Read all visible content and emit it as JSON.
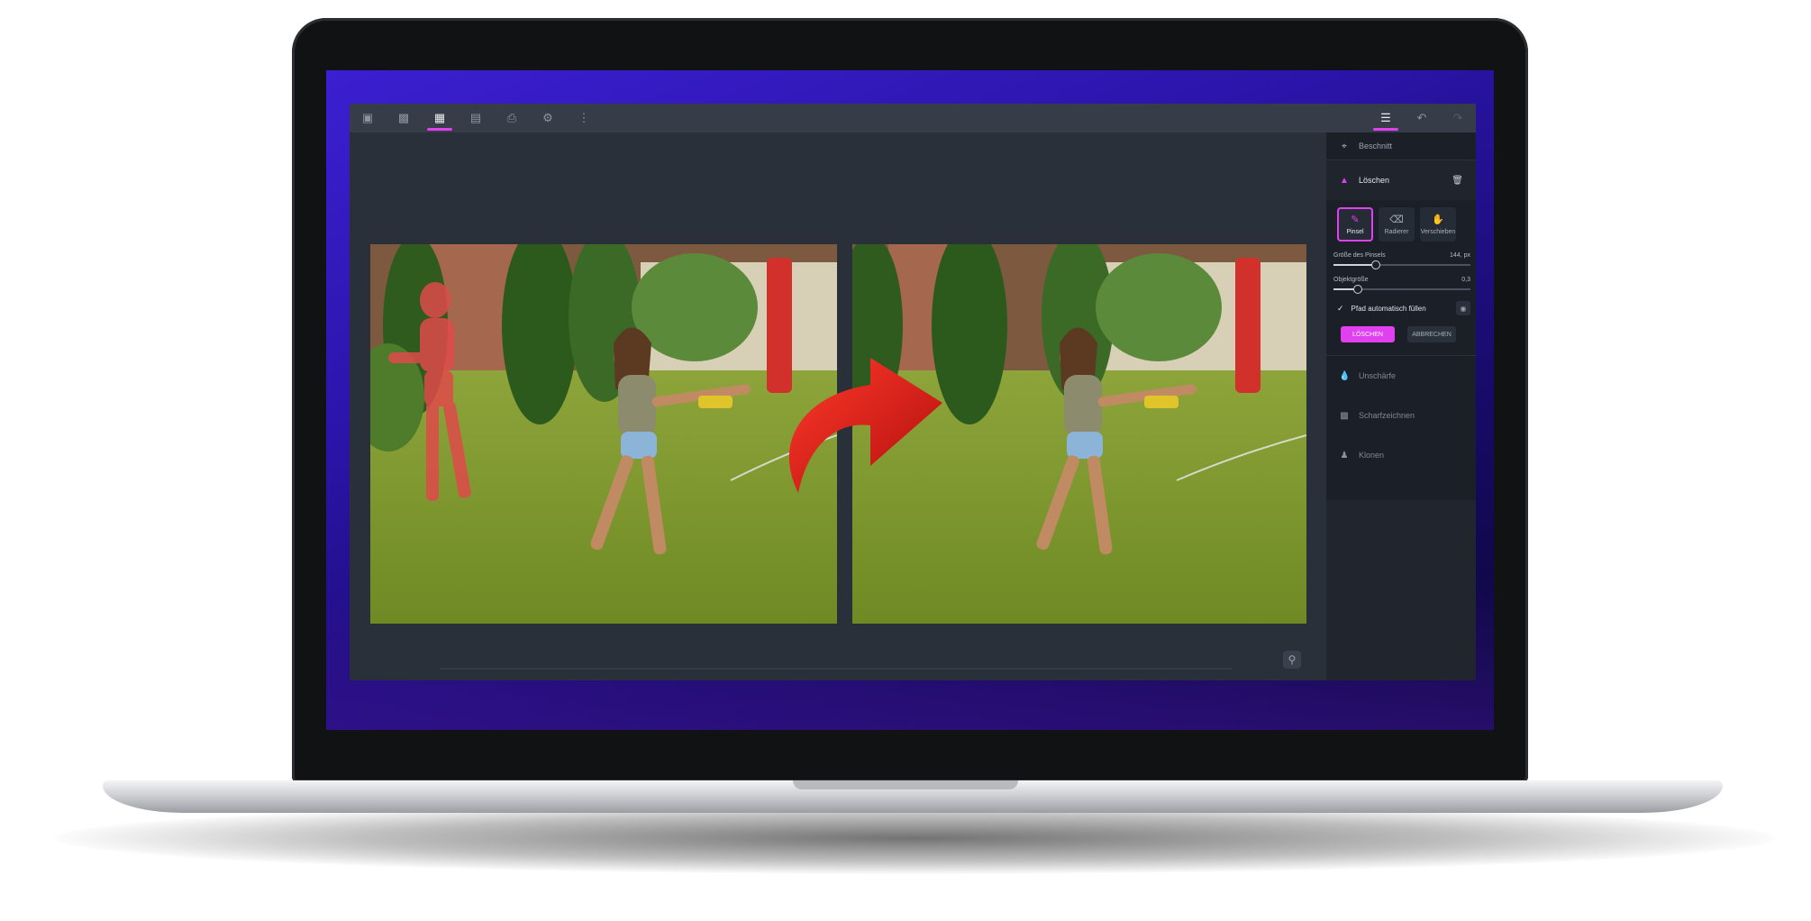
{
  "toolbar": {
    "left_icons": [
      "new-icon",
      "open-icon",
      "image-icon",
      "save-icon",
      "print-icon",
      "settings-icon",
      "more-icon"
    ],
    "active_left_index": 2,
    "right_icons": [
      "adjustments-icon",
      "undo-icon",
      "redo-icon"
    ]
  },
  "panel": {
    "crop_label": "Beschnitt",
    "erase_label": "Löschen",
    "tools": [
      {
        "label": "Pinsel",
        "active": true
      },
      {
        "label": "Radierer",
        "active": false
      },
      {
        "label": "Verschieben",
        "active": false
      }
    ],
    "brush_size_label": "Größe des Pinsels",
    "brush_size_value": "144, px",
    "brush_size_fraction": 0.3,
    "object_size_label": "Objektgröße",
    "object_size_value": "0,3",
    "object_size_fraction": 0.17,
    "autofill_label": "Pfad automatisch füllen",
    "autofill_checked": true,
    "apply_label": "LÖSCHEN",
    "cancel_label": "ABBRECHEN",
    "other_tools": [
      "Unschärfe",
      "Scharfzeichnen",
      "Klonen"
    ]
  },
  "colors": {
    "accent": "#e040f0",
    "app_bg": "#2b313b",
    "panel_bg": "#1b2028"
  }
}
